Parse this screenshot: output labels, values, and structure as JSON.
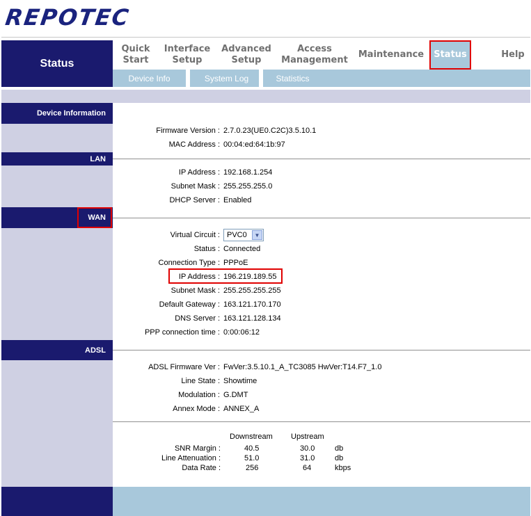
{
  "brand": {
    "logo_text": "REPOTEC"
  },
  "header": {
    "page_title": "Status",
    "menu": [
      {
        "line1": "Quick",
        "line2": "Start"
      },
      {
        "line1": "Interface",
        "line2": "Setup"
      },
      {
        "line1": "Advanced",
        "line2": "Setup"
      },
      {
        "line1": "Access",
        "line2": "Management"
      },
      {
        "line1": "Maintenance",
        "line2": ""
      },
      {
        "line1": "Status",
        "line2": ""
      },
      {
        "line1": "Help",
        "line2": ""
      }
    ],
    "submenu": [
      "Device Info",
      "System Log",
      "Statistics"
    ]
  },
  "sections": {
    "device": "Device Information",
    "lan": "LAN",
    "wan": "WAN",
    "adsl": "ADSL"
  },
  "device_info": {
    "firmware_label": "Firmware Version :",
    "firmware_value": "2.7.0.23(UE0.C2C)3.5.10.1",
    "mac_label": "MAC Address :",
    "mac_value": "00:04:ed:64:1b:97"
  },
  "lan": {
    "ip_label": "IP Address :",
    "ip_value": "192.168.1.254",
    "mask_label": "Subnet Mask :",
    "mask_value": "255.255.255.0",
    "dhcp_label": "DHCP Server :",
    "dhcp_value": "Enabled"
  },
  "wan": {
    "vc_label": "Virtual Circuit :",
    "vc_value": "PVC0",
    "status_label": "Status :",
    "status_value": "Connected",
    "conn_label": "Connection Type :",
    "conn_value": "PPPoE",
    "ip_label": "IP Address :",
    "ip_value": "196.219.189.55",
    "mask_label": "Subnet Mask :",
    "mask_value": "255.255.255.255",
    "gw_label": "Default Gateway :",
    "gw_value": "163.121.170.170",
    "dns_label": "DNS Server :",
    "dns_value": "163.121.128.134",
    "ppp_label": "PPP connection time :",
    "ppp_value": "0:00:06:12"
  },
  "adsl": {
    "fw_label": "ADSL Firmware Ver :",
    "fw_value": "FwVer:3.5.10.1_A_TC3085 HwVer:T14.F7_1.0",
    "line_label": "Line State :",
    "line_value": "Showtime",
    "mod_label": "Modulation :",
    "mod_value": "G.DMT",
    "annex_label": "Annex Mode :",
    "annex_value": "ANNEX_A"
  },
  "stats": {
    "col_down": "Downstream",
    "col_up": "Upstream",
    "rows": [
      {
        "label": "SNR Margin :",
        "down": "40.5",
        "up": "30.0",
        "unit": "db"
      },
      {
        "label": "Line Attenuation :",
        "down": "51.0",
        "up": "31.0",
        "unit": "db"
      },
      {
        "label": "Data Rate :",
        "down": "256",
        "up": "64",
        "unit": "kbps"
      }
    ]
  },
  "colors": {
    "navy": "#1a1a6e",
    "light_blue": "#a8c8db",
    "sidebar": "#cfd0e3",
    "highlight": "#e00000"
  }
}
